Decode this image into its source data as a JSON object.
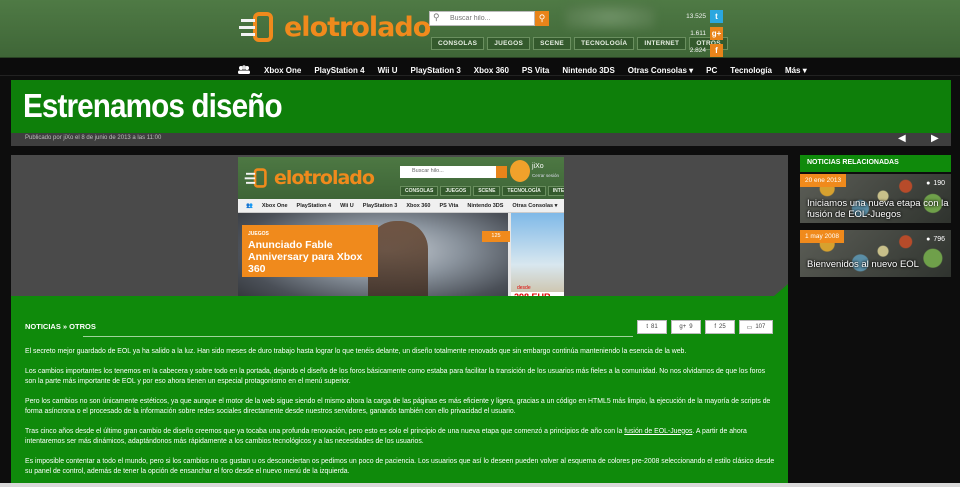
{
  "header": {
    "logo_text": "elotrolado",
    "search_placeholder": "Buscar hilo...",
    "categories": [
      "CONSOLAS",
      "JUEGOS",
      "SCENE",
      "TECNOLOGÍA",
      "INTERNET",
      "OTROS"
    ],
    "social": [
      {
        "count": "13.525",
        "network": "twitter",
        "glyph": "t",
        "color": "#2aa7df"
      },
      {
        "count": "1.611",
        "network": "google-plus",
        "glyph": "g+",
        "color": "#e8841a"
      },
      {
        "count": "2.824",
        "network": "facebook",
        "glyph": "f",
        "color": "#e8841a"
      }
    ]
  },
  "platform_nav": [
    "Xbox One",
    "PlayStation 4",
    "Wii U",
    "PlayStation 3",
    "Xbox 360",
    "PS Vita",
    "Nintendo 3DS",
    "Otras Consolas ▾",
    "PC",
    "Tecnología",
    "Más ▾"
  ],
  "title": "Estrenamos diseño",
  "meta": "Publicado por jiXo el 8 de junio de 2013 a las 11:00",
  "preview": {
    "logo_text": "elotrolado",
    "search_placeholder": "Buscar hilo...",
    "user_name": "jiXo",
    "user_action": "Cerrar sesión",
    "categories": [
      "CONSOLAS",
      "JUEGOS",
      "SCENE",
      "TECNOLOGÍA",
      "INTERN"
    ],
    "nav": [
      "Xbox One",
      "PlayStation 4",
      "Wii U",
      "PlayStation 3",
      "Xbox 360",
      "PS Vita",
      "Nintendo 3DS",
      "Otras Consolas ▾"
    ],
    "tag_kicker": "JUEGOS",
    "tag_headline": "Anunciado Fable Anniversary para Xbox 360",
    "comments": "125",
    "ad_from": "desde",
    "ad_price": "298 EUR"
  },
  "article": {
    "section": "NOTICIAS » OTROS",
    "shares": [
      {
        "icon": "twitter-icon",
        "glyph": "t",
        "count": "81"
      },
      {
        "icon": "google-plus-icon",
        "glyph": "g+",
        "count": "9"
      },
      {
        "icon": "facebook-icon",
        "glyph": "f",
        "count": "25"
      },
      {
        "icon": "comments-icon",
        "glyph": "▭",
        "count": "107"
      }
    ],
    "p1": "El secreto mejor guardado de EOL ya ha salido a la luz. Han sido meses de duro trabajo hasta lograr lo que tenéis delante, un diseño totalmente renovado que sin embargo continúa manteniendo la esencia de la web.",
    "p2": "Los cambios importantes los tenemos en la cabecera y sobre todo en la portada, dejando el diseño de los foros básicamente como estaba para facilitar la transición de los usuarios más fieles a la comunidad. No nos olvidamos de que los foros son la parte más importante de EOL y por eso ahora tienen un especial protagonismo en el menú superior.",
    "p3": "Pero los cambios no son únicamente estéticos, ya que aunque el motor de la web sigue siendo el mismo ahora la carga de las páginas es más eficiente y ligera, gracias a un código en HTML5 más limpio, la ejecución de la mayoría de scripts de forma asíncrona o el procesado de la información sobre redes sociales directamente desde nuestros servidores, ganando también con ello privacidad el usuario.",
    "p4_before": "Tras cinco años desde el último gran cambio de diseño creemos que ya tocaba una profunda renovación, pero esto es solo el principio de una nueva etapa que comenzó a principios de año con la ",
    "p4_link": "fusión de EOL-Juegos",
    "p4_after": ". A partir de ahora intentaremos ser más dinámicos, adaptándonos más rápidamente a los cambios tecnológicos y a las necesidades de los usuarios.",
    "p5": "Es imposible contentar a todo el mundo, pero si los cambios no os gustan u os desconciertan os pedimos un poco de paciencia. Los usuarios que así lo deseen pueden volver al esquema de colores pre-2008 seleccionando el estilo clásico desde su panel de control, además de tener la opción de ensanchar el foro desde el nuevo menú de la izquierda."
  },
  "sidebar": {
    "heading": "NOTICIAS RELACIONADAS",
    "cards": [
      {
        "date": "20 ene 2013",
        "comments": "190",
        "title": "Iniciamos una nueva etapa con la fusión de EOL-Juegos"
      },
      {
        "date": "1 may 2008",
        "comments": "796",
        "title": "Bienvenidos al nuevo EOL"
      }
    ]
  },
  "colors": {
    "brand_orange": "#f08a1c",
    "header_green": "#4f7a45",
    "banner_green": "#0e7f0a"
  }
}
